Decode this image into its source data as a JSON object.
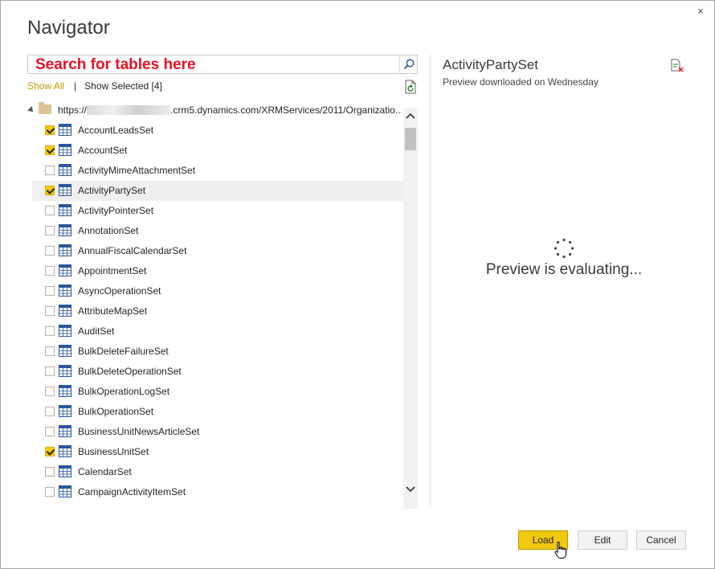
{
  "window": {
    "title": "Navigator",
    "close_glyph": "×"
  },
  "search": {
    "text": "Search for tables here",
    "icon": "search-icon"
  },
  "filters": {
    "show_all": "Show All",
    "separator": "|",
    "show_selected": "Show Selected [4]"
  },
  "tree": {
    "root": {
      "prefix": "https://",
      "suffix": ".crm5.dynamics.com/XRMServices/2011/Organizatio..."
    },
    "items": [
      {
        "label": "AccountLeadsSet",
        "checked": true
      },
      {
        "label": "AccountSet",
        "checked": true
      },
      {
        "label": "ActivityMimeAttachmentSet",
        "checked": false
      },
      {
        "label": "ActivityPartySet",
        "checked": true,
        "selected": true
      },
      {
        "label": "ActivityPointerSet",
        "checked": false
      },
      {
        "label": "AnnotationSet",
        "checked": false
      },
      {
        "label": "AnnualFiscalCalendarSet",
        "checked": false
      },
      {
        "label": "AppointmentSet",
        "checked": false
      },
      {
        "label": "AsyncOperationSet",
        "checked": false
      },
      {
        "label": "AttributeMapSet",
        "checked": false
      },
      {
        "label": "AuditSet",
        "checked": false
      },
      {
        "label": "BulkDeleteFailureSet",
        "checked": false
      },
      {
        "label": "BulkDeleteOperationSet",
        "checked": false
      },
      {
        "label": "BulkOperationLogSet",
        "checked": false
      },
      {
        "label": "BulkOperationSet",
        "checked": false
      },
      {
        "label": "BusinessUnitNewsArticleSet",
        "checked": false
      },
      {
        "label": "BusinessUnitSet",
        "checked": true
      },
      {
        "label": "CalendarSet",
        "checked": false
      },
      {
        "label": "CampaignActivityItemSet",
        "checked": false
      }
    ]
  },
  "preview": {
    "title": "ActivityPartySet",
    "subtitle": "Preview downloaded on Wednesday",
    "status": "Preview is evaluating..."
  },
  "buttons": {
    "load": "Load",
    "edit": "Edit",
    "cancel": "Cancel"
  },
  "colors": {
    "accent": "#f2c811",
    "search_text": "#e81123",
    "show_all_link": "#c19c00",
    "table_icon": "#2b579a"
  }
}
